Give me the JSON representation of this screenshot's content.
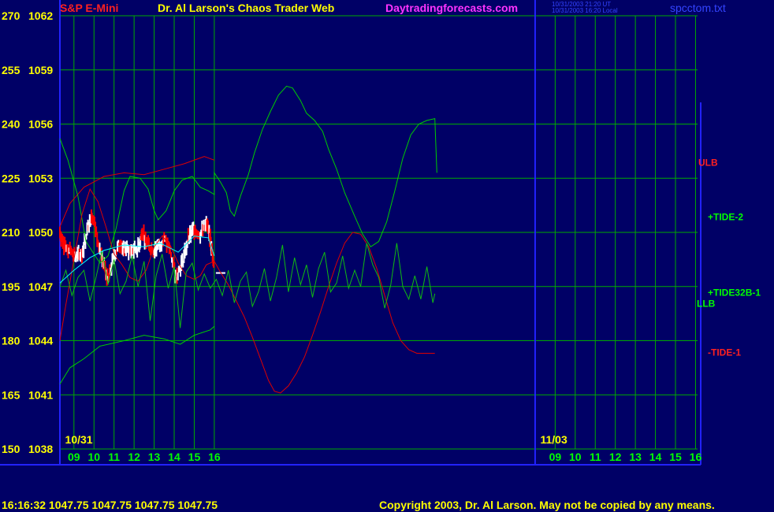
{
  "header": {
    "instrument": "S&P E-Mini",
    "title": "Dr. Al Larson's Chaos Trader Web",
    "site": "Daytradingforecasts.com",
    "timestamp1": "10/31/2003 21:20 UT",
    "timestamp2": "10/31/2003 16:20 Local",
    "file": "spcctom.txt"
  },
  "footer": {
    "quote": "16:16:32  1047.75 1047.75 1047.75 1047.75",
    "copyright": "Copyright 2003, Dr. Al Larson. May not be copied by any means."
  },
  "colors": {
    "background": "#000066",
    "grid": "#00aa00",
    "price_up": "#ffffff",
    "price_down": "#ff0000",
    "tide_green": "#00cc00",
    "tide_red": "#dd0000",
    "axis_text": "#ffff00",
    "time_text": "#00ff00",
    "header_red": "#ff2020",
    "header_yellow": "#ffff00",
    "header_magenta": "#ff33ff",
    "divider": "#2222ff"
  },
  "chart_data": {
    "type": "line",
    "y_left_labels": [
      "270",
      "255",
      "240",
      "225",
      "210",
      "195",
      "180",
      "165",
      "150"
    ],
    "y_left_values": [
      270,
      255,
      240,
      225,
      210,
      195,
      180,
      165,
      150
    ],
    "y_right_labels": [
      "1062",
      "1059",
      "1056",
      "1053",
      "1050",
      "1047",
      "1044",
      "1041",
      "1038"
    ],
    "y_right_values": [
      1062,
      1059,
      1056,
      1053,
      1050,
      1047,
      1044,
      1041,
      1038
    ],
    "ylim": [
      1038,
      1062
    ],
    "x_ticks": [
      "09",
      "10",
      "11",
      "12",
      "13",
      "14",
      "15",
      "16",
      "09",
      "10",
      "11",
      "12",
      "13",
      "14",
      "15",
      "16"
    ],
    "x_tick_hours": [
      9,
      10,
      11,
      12,
      13,
      14,
      15,
      16,
      33,
      34,
      35,
      36,
      37,
      38,
      39,
      40
    ],
    "xlim": [
      8.3,
      40.1
    ],
    "date_labels": [
      {
        "text": "10/31",
        "hour": 8.4
      },
      {
        "text": "11/03",
        "hour": 32.1
      }
    ],
    "session_divider_hour": 32.0,
    "last_price": 1047.75,
    "series_labels": [
      {
        "name": "ULB",
        "y": 1053.9,
        "color": "#ff2020"
      },
      {
        "name": "+TIDE-2",
        "y": 1050.9,
        "color": "#00ff00"
      },
      {
        "name": "+TIDE32B-1",
        "y": 1046.7,
        "color": "#00ff00"
      },
      {
        "name": "LLB",
        "y": 1046.1,
        "color": "#00ff00"
      },
      {
        "name": "-TIDE-1",
        "y": 1043.4,
        "color": "#ff2020"
      }
    ],
    "series": [
      {
        "key": "ulb",
        "color": "#dd0000",
        "width": 1,
        "points": [
          [
            8.3,
            1050.3
          ],
          [
            8.8,
            1051.6
          ],
          [
            9.5,
            1052.5
          ],
          [
            10.5,
            1053.1
          ],
          [
            11.5,
            1053.3
          ],
          [
            12.5,
            1053.2
          ],
          [
            13.5,
            1053.5
          ],
          [
            14.5,
            1053.8
          ],
          [
            15.5,
            1054.2
          ],
          [
            16.0,
            1054.0
          ]
        ]
      },
      {
        "key": "llb",
        "color": "#00cc00",
        "width": 1,
        "points": [
          [
            8.3,
            1041.6
          ],
          [
            8.8,
            1042.5
          ],
          [
            9.5,
            1043.0
          ],
          [
            10.3,
            1043.7
          ],
          [
            11.5,
            1044.0
          ],
          [
            12.5,
            1044.3
          ],
          [
            13.5,
            1044.1
          ],
          [
            14.3,
            1043.8
          ],
          [
            15.0,
            1044.3
          ],
          [
            15.8,
            1044.6
          ],
          [
            16.0,
            1044.8
          ]
        ]
      },
      {
        "key": "tide2",
        "color": "#00cc00",
        "width": 1,
        "points": [
          [
            8.3,
            1055.2
          ],
          [
            8.7,
            1054.0
          ],
          [
            9.2,
            1052.0
          ],
          [
            9.6,
            1049.5
          ],
          [
            10.0,
            1048.8
          ],
          [
            10.3,
            1048.3
          ],
          [
            10.7,
            1048.7
          ],
          [
            11.1,
            1050.2
          ],
          [
            11.5,
            1052.3
          ],
          [
            11.8,
            1053.1
          ],
          [
            12.3,
            1053.0
          ],
          [
            12.7,
            1052.4
          ],
          [
            13.0,
            1051.2
          ],
          [
            13.2,
            1050.7
          ],
          [
            13.6,
            1051.2
          ],
          [
            14.0,
            1052.3
          ],
          [
            14.4,
            1052.9
          ],
          [
            14.9,
            1053.1
          ],
          [
            15.3,
            1052.5
          ],
          [
            15.7,
            1052.3
          ],
          [
            16.0,
            1052.1
          ],
          [
            16.0,
            1053.3
          ],
          [
            16.3,
            1052.8
          ],
          [
            16.6,
            1052.2
          ],
          [
            16.8,
            1051.2
          ],
          [
            17.0,
            1050.9
          ],
          [
            17.3,
            1052.0
          ],
          [
            17.7,
            1053.2
          ],
          [
            18.0,
            1054.4
          ],
          [
            18.4,
            1055.7
          ],
          [
            18.8,
            1056.7
          ],
          [
            19.2,
            1057.6
          ],
          [
            19.6,
            1058.1
          ],
          [
            19.9,
            1058.0
          ],
          [
            20.3,
            1057.3
          ],
          [
            20.6,
            1056.6
          ],
          [
            21.0,
            1056.2
          ],
          [
            21.4,
            1055.6
          ],
          [
            21.7,
            1054.6
          ],
          [
            22.1,
            1053.5
          ],
          [
            22.5,
            1052.2
          ],
          [
            23.0,
            1050.9
          ],
          [
            23.4,
            1049.9
          ],
          [
            23.8,
            1049.2
          ],
          [
            24.2,
            1049.5
          ],
          [
            24.6,
            1050.6
          ],
          [
            25.0,
            1052.3
          ],
          [
            25.4,
            1054.1
          ],
          [
            25.8,
            1055.4
          ],
          [
            26.2,
            1056.0
          ],
          [
            26.6,
            1056.2
          ],
          [
            27.0,
            1056.3
          ],
          [
            27.1,
            1053.3
          ]
        ]
      },
      {
        "key": "tide1",
        "color": "#dd0000",
        "width": 1,
        "points": [
          [
            8.3,
            1044.0
          ],
          [
            8.6,
            1046.0
          ],
          [
            9.0,
            1048.5
          ],
          [
            9.4,
            1051.0
          ],
          [
            9.8,
            1052.4
          ],
          [
            10.2,
            1051.7
          ],
          [
            10.6,
            1050.3
          ],
          [
            11.0,
            1048.8
          ],
          [
            11.4,
            1048.2
          ],
          [
            11.8,
            1047.5
          ],
          [
            12.2,
            1047.3
          ],
          [
            12.6,
            1047.9
          ],
          [
            13.0,
            1049.2
          ],
          [
            13.4,
            1049.8
          ],
          [
            13.8,
            1049.3
          ],
          [
            14.2,
            1048.3
          ],
          [
            14.6,
            1047.6
          ],
          [
            15.0,
            1047.4
          ],
          [
            15.3,
            1047.6
          ],
          [
            15.6,
            1048.2
          ],
          [
            16.0,
            1048.4
          ],
          [
            16.3,
            1047.8
          ],
          [
            16.7,
            1047.1
          ],
          [
            17.1,
            1046.2
          ],
          [
            17.5,
            1045.3
          ],
          [
            17.9,
            1044.2
          ],
          [
            18.3,
            1043.0
          ],
          [
            18.7,
            1041.8
          ],
          [
            19.0,
            1041.2
          ],
          [
            19.3,
            1041.1
          ],
          [
            19.7,
            1041.5
          ],
          [
            20.1,
            1042.2
          ],
          [
            20.5,
            1043.1
          ],
          [
            20.9,
            1044.3
          ],
          [
            21.3,
            1045.6
          ],
          [
            21.7,
            1047.0
          ],
          [
            22.1,
            1048.3
          ],
          [
            22.5,
            1049.4
          ],
          [
            22.9,
            1050.0
          ],
          [
            23.3,
            1049.9
          ],
          [
            23.7,
            1049.2
          ],
          [
            24.1,
            1048.0
          ],
          [
            24.5,
            1046.5
          ],
          [
            24.9,
            1045.0
          ],
          [
            25.3,
            1044.0
          ],
          [
            25.7,
            1043.5
          ],
          [
            26.1,
            1043.3
          ],
          [
            26.5,
            1043.3
          ],
          [
            27.0,
            1043.3
          ]
        ]
      },
      {
        "key": "tide32b",
        "color": "#11bb11",
        "width": 1,
        "points": [
          [
            8.3,
            1047.0
          ],
          [
            8.6,
            1047.9
          ],
          [
            8.9,
            1046.5
          ],
          [
            9.2,
            1047.5
          ],
          [
            9.5,
            1047.9
          ],
          [
            9.8,
            1046.2
          ],
          [
            10.1,
            1047.5
          ],
          [
            10.4,
            1049.0
          ],
          [
            10.7,
            1047.1
          ],
          [
            11.0,
            1048.5
          ],
          [
            11.3,
            1046.6
          ],
          [
            11.6,
            1047.3
          ],
          [
            11.9,
            1048.7
          ],
          [
            12.2,
            1047.0
          ],
          [
            12.5,
            1048.4
          ],
          [
            12.8,
            1045.1
          ],
          [
            13.1,
            1047.6
          ],
          [
            13.4,
            1048.8
          ],
          [
            13.7,
            1046.9
          ],
          [
            14.0,
            1048.1
          ],
          [
            14.3,
            1044.7
          ],
          [
            14.6,
            1047.8
          ],
          [
            14.9,
            1048.3
          ],
          [
            15.2,
            1046.8
          ],
          [
            15.5,
            1047.7
          ],
          [
            15.8,
            1046.9
          ],
          [
            16.1,
            1047.4
          ],
          [
            16.4,
            1046.5
          ],
          [
            16.7,
            1047.9
          ],
          [
            17.0,
            1046.1
          ],
          [
            17.3,
            1047.3
          ],
          [
            17.6,
            1047.8
          ],
          [
            17.9,
            1045.9
          ],
          [
            18.2,
            1046.7
          ],
          [
            18.5,
            1048.0
          ],
          [
            18.8,
            1046.2
          ],
          [
            19.1,
            1047.5
          ],
          [
            19.4,
            1049.3
          ],
          [
            19.7,
            1046.7
          ],
          [
            20.0,
            1048.6
          ],
          [
            20.3,
            1047.1
          ],
          [
            20.6,
            1048.2
          ],
          [
            20.9,
            1046.4
          ],
          [
            21.2,
            1048.0
          ],
          [
            21.5,
            1048.9
          ],
          [
            21.8,
            1046.7
          ],
          [
            22.1,
            1047.2
          ],
          [
            22.4,
            1048.7
          ],
          [
            22.7,
            1046.9
          ],
          [
            23.0,
            1047.9
          ],
          [
            23.3,
            1047.0
          ],
          [
            23.6,
            1049.4
          ],
          [
            23.9,
            1048.2
          ],
          [
            24.2,
            1047.5
          ],
          [
            24.5,
            1045.8
          ],
          [
            24.8,
            1047.1
          ],
          [
            25.1,
            1049.4
          ],
          [
            25.4,
            1047.0
          ],
          [
            25.7,
            1046.3
          ],
          [
            26.0,
            1047.6
          ],
          [
            26.3,
            1046.3
          ],
          [
            26.6,
            1048.1
          ],
          [
            26.9,
            1046.1
          ],
          [
            27.0,
            1046.6
          ]
        ]
      },
      {
        "key": "price_avg",
        "color": "#00ffff",
        "width": 1,
        "points": [
          [
            8.3,
            1047.2
          ],
          [
            9.0,
            1047.9
          ],
          [
            9.8,
            1048.6
          ],
          [
            10.5,
            1049.0
          ],
          [
            11.5,
            1049.3
          ],
          [
            12.5,
            1049.2
          ],
          [
            13.3,
            1049.4
          ],
          [
            14.2,
            1048.9
          ],
          [
            15.0,
            1049.8
          ],
          [
            15.7,
            1049.7
          ],
          [
            16.0,
            1048.7
          ]
        ]
      }
    ],
    "price_path": [
      [
        8.3,
        1050.0
      ],
      [
        8.5,
        1049.4
      ],
      [
        8.8,
        1049.0
      ],
      [
        9.1,
        1048.6
      ],
      [
        9.4,
        1048.8
      ],
      [
        9.7,
        1050.3
      ],
      [
        9.9,
        1051.1
      ],
      [
        10.2,
        1049.6
      ],
      [
        10.5,
        1048.1
      ],
      [
        10.7,
        1047.3
      ],
      [
        11.0,
        1048.7
      ],
      [
        11.3,
        1049.4
      ],
      [
        11.6,
        1049.0
      ],
      [
        11.9,
        1049.0
      ],
      [
        12.2,
        1049.1
      ],
      [
        12.4,
        1050.0
      ],
      [
        12.7,
        1049.3
      ],
      [
        13.0,
        1049.0
      ],
      [
        13.2,
        1049.3
      ],
      [
        13.5,
        1049.6
      ],
      [
        13.8,
        1049.0
      ],
      [
        14.1,
        1047.6
      ],
      [
        14.4,
        1048.3
      ],
      [
        14.7,
        1049.6
      ],
      [
        15.0,
        1050.2
      ],
      [
        15.3,
        1049.9
      ],
      [
        15.6,
        1050.4
      ],
      [
        15.8,
        1049.7
      ],
      [
        16.0,
        1048.3
      ]
    ],
    "last_price_mark": {
      "hour": 16.0,
      "y": 1047.75
    }
  }
}
